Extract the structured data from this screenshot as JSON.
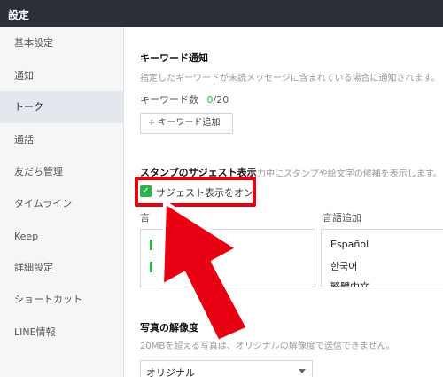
{
  "window": {
    "title": "設定"
  },
  "sidebar": {
    "items": [
      {
        "label": "基本設定"
      },
      {
        "label": "通知"
      },
      {
        "label": "トーク"
      },
      {
        "label": "通話"
      },
      {
        "label": "友だち管理"
      },
      {
        "label": "タイムライン"
      },
      {
        "label": "Keep"
      },
      {
        "label": "詳細設定"
      },
      {
        "label": "ショートカット"
      },
      {
        "label": "LINE情報"
      }
    ],
    "active_index": 2
  },
  "keyword": {
    "title": "キーワード通知",
    "description": "指定したキーワードが未読メッセージに含まれている場合に通知されます。",
    "count_label": "キーワード数",
    "count_current": "0",
    "count_separator": "/",
    "count_max": "20",
    "add_button": "+ キーワード追加"
  },
  "sticker": {
    "title": "スタンプのサジェスト表示",
    "description": "入力中にスタンプや絵文字の候補を表示します。",
    "checkbox_label": "サジェスト表示をオン",
    "checked": true,
    "column_left_header": "言",
    "column_right_header": "言語追加",
    "languages": [
      "Español",
      "한국어",
      "繁體中文"
    ]
  },
  "photo": {
    "title": "写真の解像度",
    "description": "20MBを超える写真は、オリジナルの解像度で送信できません。",
    "selected": "オリジナル"
  },
  "colors": {
    "accent": "#2cb34a",
    "annotation": "#e60012",
    "titlebar": "#2b3038"
  }
}
